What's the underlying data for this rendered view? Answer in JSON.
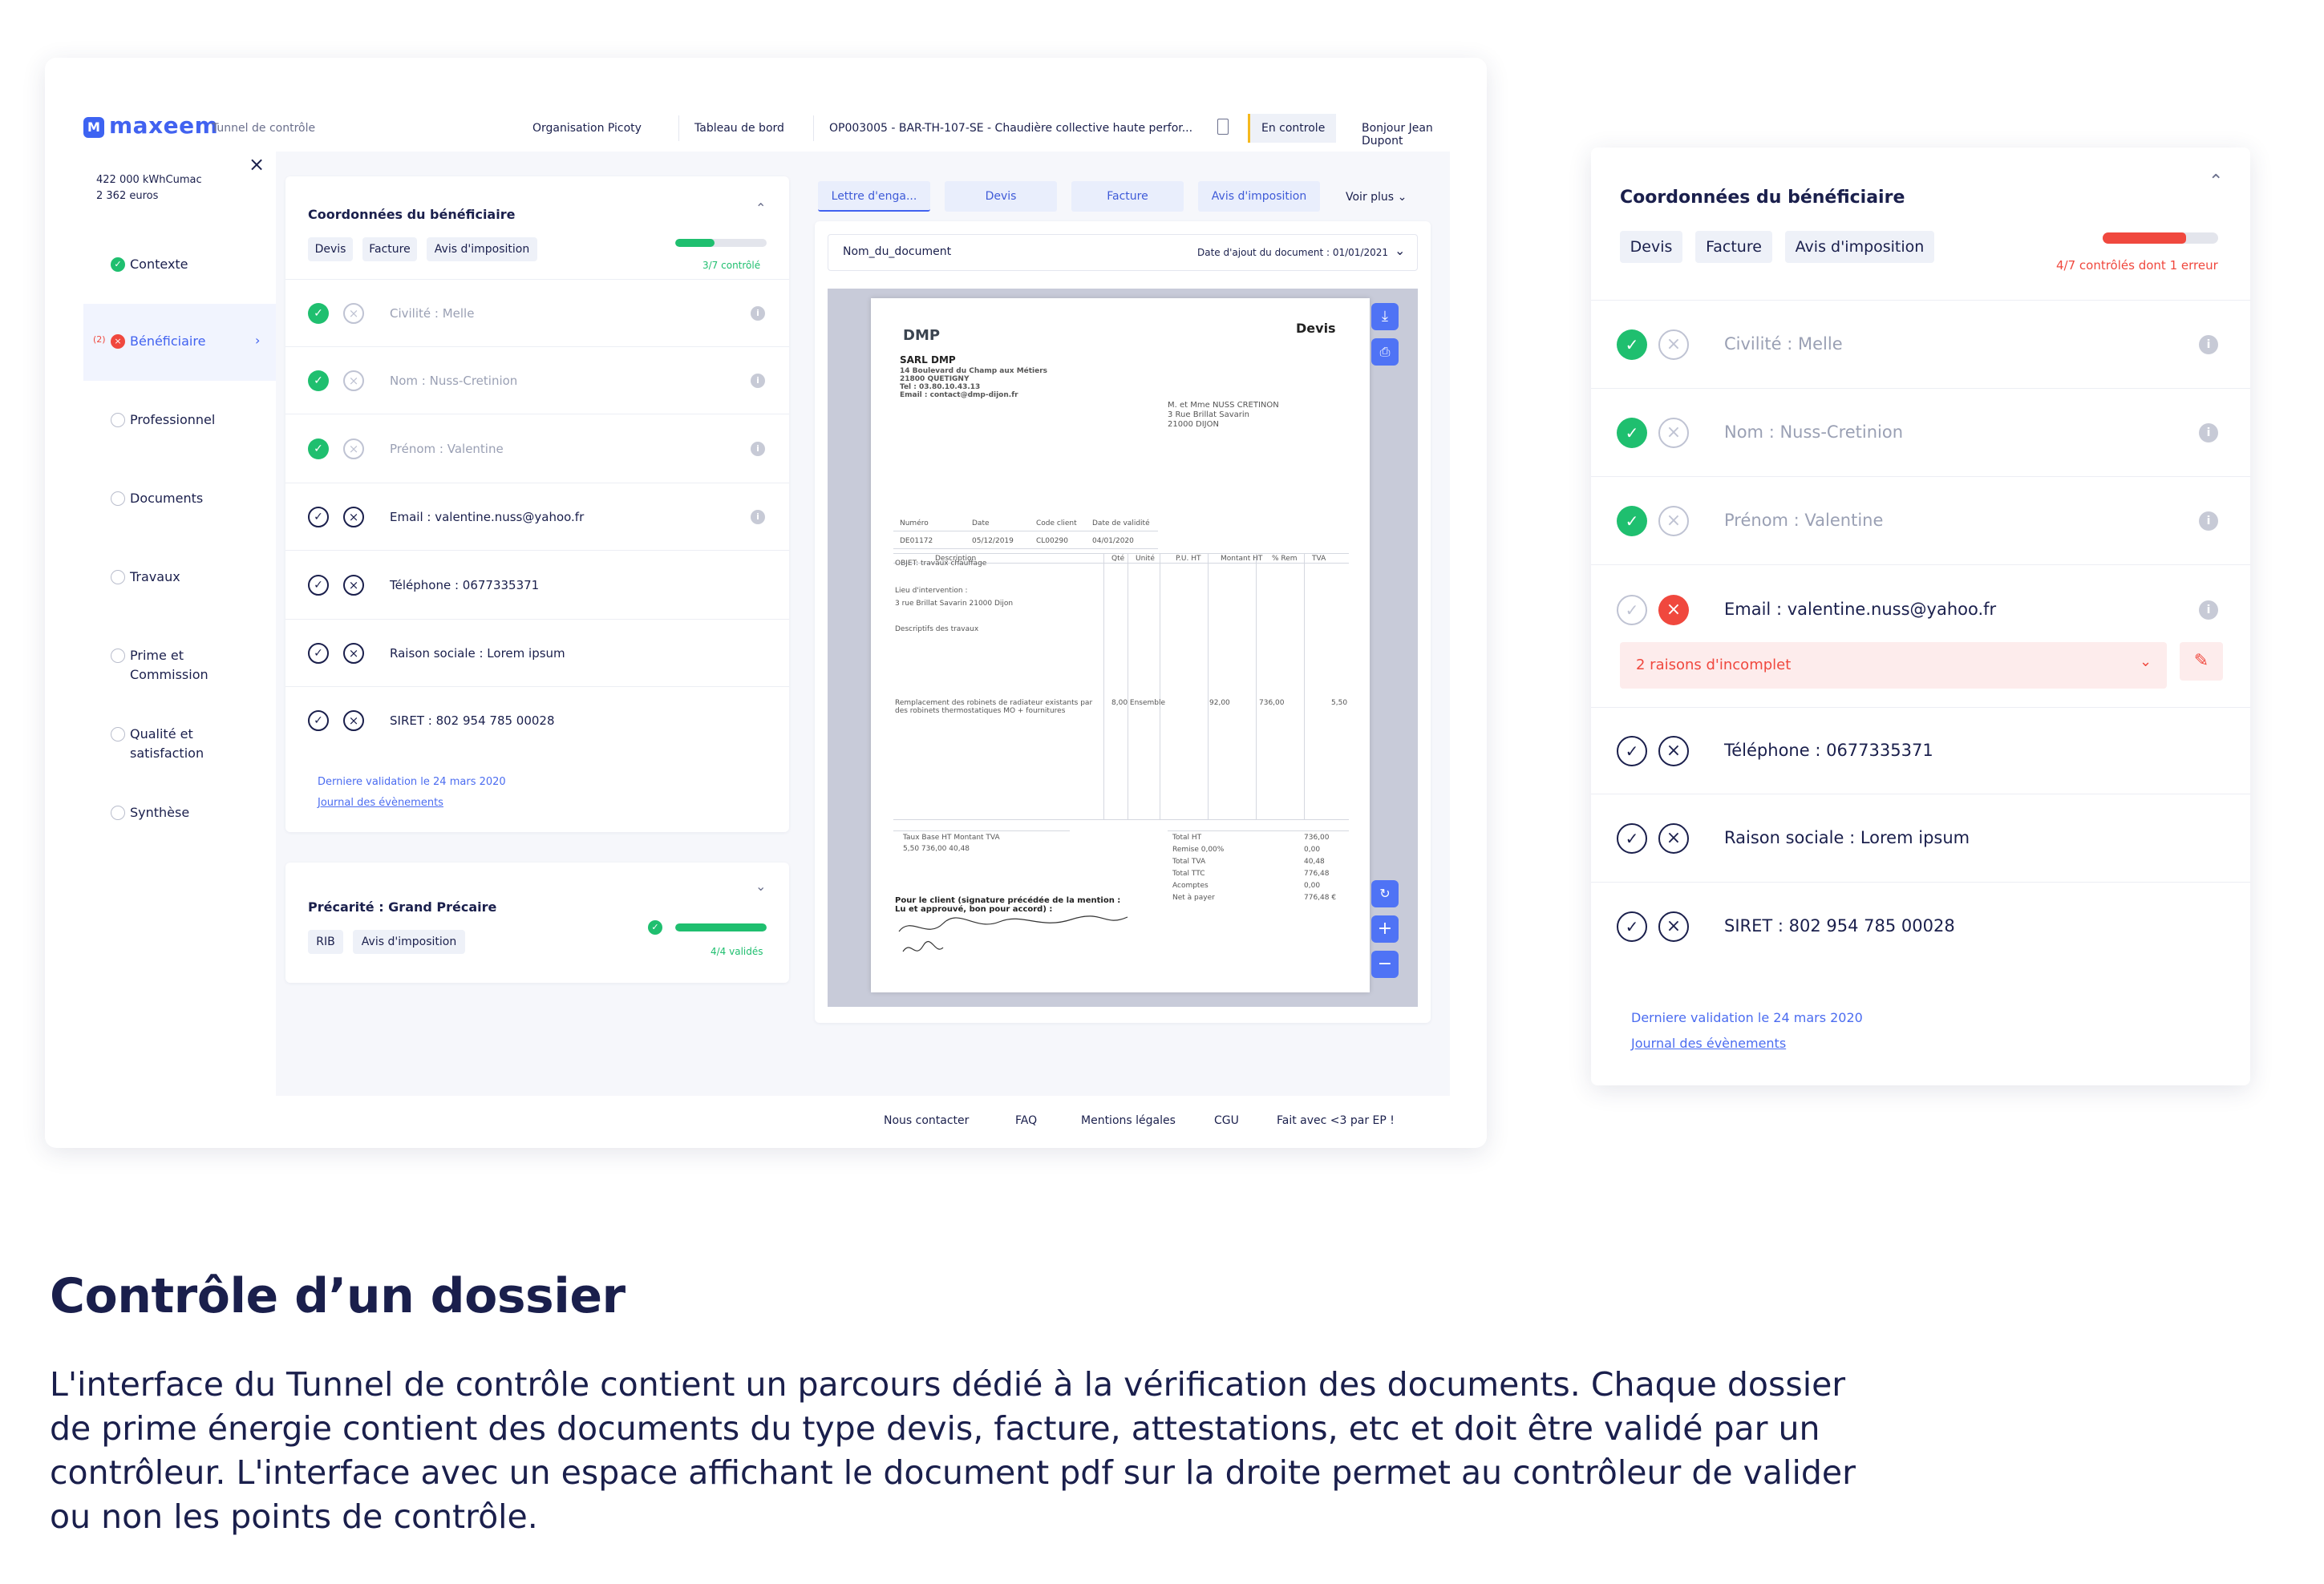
{
  "header": {
    "brand": "maxeem",
    "subtitle": "Tunnel de contrôle",
    "nav": [
      "Organisation Picoty",
      "Tableau de bord",
      "OP003005 - BAR-TH-107-SE - Chaudière collective haute perfor..."
    ],
    "status": "En controle",
    "greeting": "Bonjour Jean Dupont"
  },
  "sidebar": {
    "stat1": "422 000 kWhCumac",
    "stat2": "2 362 euros",
    "close": "×",
    "items": [
      {
        "label": "Contexte",
        "state": "done"
      },
      {
        "label": "Bénéficiaire",
        "state": "error",
        "count": "(2)"
      },
      {
        "label": "Professionnel",
        "state": "todo"
      },
      {
        "label": "Documents",
        "state": "todo"
      },
      {
        "label": "Travaux",
        "state": "todo"
      },
      {
        "label": "Prime et Commission",
        "state": "todo"
      },
      {
        "label": "Qualité et satisfaction",
        "state": "todo"
      },
      {
        "label": "Synthèse",
        "state": "todo"
      }
    ]
  },
  "beneficiaire": {
    "title": "Coordonnées du bénéficiaire",
    "tags": [
      "Devis",
      "Facture",
      "Avis d'imposition"
    ],
    "progress_text": "3/7 contrôlé",
    "progress": 0.43,
    "rows": [
      {
        "label": "Civilité : Melle",
        "state": "valid"
      },
      {
        "label": "Nom : Nuss-Cretinion",
        "state": "valid"
      },
      {
        "label": "Prénom : Valentine",
        "state": "valid"
      },
      {
        "label": "Email : valentine.nuss@yahoo.fr",
        "state": "pending"
      },
      {
        "label": "Téléphone : 0677335371",
        "state": "pending"
      },
      {
        "label": "Raison sociale : Lorem ipsum",
        "state": "pending"
      },
      {
        "label": "SIRET : 802 954 785 00028",
        "state": "pending"
      }
    ],
    "last_validation": "Derniere validation le 24 mars 2020",
    "journal": "Journal des évènements"
  },
  "precarite": {
    "title": "Précarité : Grand Précaire",
    "tags": [
      "RIB",
      "Avis d'imposition"
    ],
    "progress_text": "4/4 validés",
    "progress": 1.0
  },
  "doc_viewer": {
    "tabs": [
      "Lettre d'enga...",
      "Devis",
      "Facture",
      "Avis d'imposition"
    ],
    "more": "Voir plus",
    "doc_name": "Nom_du_document",
    "doc_date": "Date d'ajout du document : 01/01/2021",
    "pdf": {
      "logo": "DMP",
      "doc_type": "Devis",
      "company": "SARL DMP",
      "address1": "14 Boulevard du Champ aux Métiers",
      "address2": "21800 QUETIGNY",
      "tel": "Tel : 03.80.10.43.13",
      "email": "Email : contact@dmp-dijon.fr",
      "client1": "M. et Mme NUSS CRETINON",
      "client2": "3 Rue Brillat Savarin",
      "client3": "21000 DIJON",
      "meta_headers": [
        "Numéro",
        "Date",
        "Code client",
        "Date de validité"
      ],
      "meta_values": [
        "DE01172",
        "05/12/2019",
        "CL00290",
        "04/01/2020"
      ],
      "line_headers": [
        "Description",
        "Qté",
        "Unité",
        "P.U. HT",
        "Montant HT",
        "% Rem",
        "TVA"
      ],
      "totals_labels": [
        "Total HT",
        "Remise 0,00%",
        "Total TVA",
        "Total TTC",
        "Acomptes",
        "Net à payer"
      ],
      "totals_values": [
        "736,00",
        "0,00",
        "40,48",
        "776,48",
        "0,00",
        "776,48 €"
      ],
      "signature_text": "Pour le client (signature précédée de la mention : Lu et approuvé, bon pour accord) :"
    }
  },
  "footer": {
    "links": [
      "Nous contacter",
      "FAQ",
      "Mentions légales",
      "CGU",
      "Fait avec <3 par EP !"
    ]
  },
  "zoom_card": {
    "title": "Coordonnées du bénéficiaire",
    "tags": [
      "Devis",
      "Facture",
      "Avis d'imposition"
    ],
    "progress_text": "4/7 contrôlés dont 1 erreur",
    "progress": 0.72,
    "rows": [
      {
        "label": "Civilité : Melle",
        "state": "valid"
      },
      {
        "label": "Nom : Nuss-Cretinion",
        "state": "valid"
      },
      {
        "label": "Prénom : Valentine",
        "state": "valid"
      },
      {
        "label": "Email : valentine.nuss@yahoo.fr",
        "state": "error"
      },
      {
        "label": "Téléphone : 0677335371",
        "state": "pending"
      },
      {
        "label": "Raison sociale : Lorem ipsum",
        "state": "pending"
      },
      {
        "label": "SIRET : 802 954 785 00028",
        "state": "pending"
      }
    ],
    "error_dropdown": "2 raisons d'incomplet",
    "last_validation": "Derniere validation le 24 mars 2020",
    "journal": "Journal des évènements"
  },
  "caption": {
    "title": "Contrôle d’un dossier",
    "text": "L'interface du Tunnel de contrôle contient un parcours dédié à la vérification des documents. Chaque dossier de prime énergie contient des documents du type devis, facture, attestations, etc et doit être validé par un contrôleur. L'interface avec un espace affichant le document pdf sur la droite permet au contrôleur de valider ou non les points de contrôle."
  },
  "colors": {
    "accent": "#4162f0",
    "success": "#1fbf6f",
    "error": "#f0483e",
    "text": "#1a1f4c"
  }
}
